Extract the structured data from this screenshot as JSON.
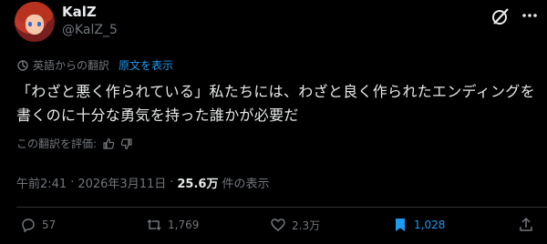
{
  "author": {
    "display_name": "KalZ",
    "handle": "@KalZ_5"
  },
  "translation": {
    "label": "英語からの翻訳",
    "show_original": "原文を表示"
  },
  "tweet": {
    "text": "「わざと悪く作られている」私たちには、わざと良く作られたエンディングを書くのに十分な勇気を持った誰かが必要だ"
  },
  "rate_translation": {
    "label": "この翻訳を評価:"
  },
  "meta": {
    "time": "午前2:41",
    "separator": "·",
    "date": "2026年3月11日",
    "views_count": "25.6万",
    "views_label": "件の表示"
  },
  "actions": {
    "replies": "57",
    "reposts": "1,769",
    "likes": "2.3万",
    "bookmarks": "1,028"
  },
  "colors": {
    "background": "#000000",
    "text": "#e7e9ea",
    "muted": "#71767b",
    "accent": "#1d9bf0"
  }
}
